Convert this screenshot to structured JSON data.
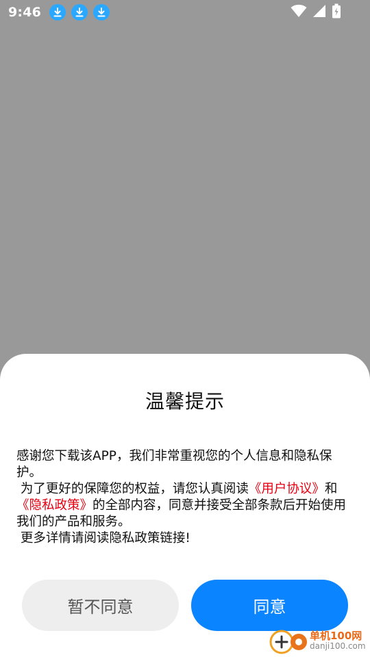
{
  "status_bar": {
    "time": "9:46",
    "notification_icons": [
      "download-icon",
      "download-icon",
      "download-icon"
    ],
    "system_icons": [
      "wifi-icon",
      "cell-signal-icon",
      "battery-charging-icon"
    ]
  },
  "dialog": {
    "title": "温馨提示",
    "body_intro": "感谢您下载该APP，我们非常重视您的个人信息和隐私保护。\n 为了更好的保障您的权益，请您认真阅读",
    "user_agreement_link": "《用户协议》",
    "body_and": "和",
    "privacy_policy_link": "《隐私政策》",
    "body_rest": "的全部内容，同意并接受全部条款后开始使用我们的产品和服务。\n 更多详情请阅读隐私政策链接!",
    "decline_label": "暂不同意",
    "agree_label": "同意"
  },
  "watermark": {
    "name": "单机100网",
    "domain": "danji100.com"
  },
  "colors": {
    "overlay": "#999999",
    "accent_blue": "#0a84ff",
    "link_red": "#e60012",
    "download_badge": "#2aa8ff"
  }
}
